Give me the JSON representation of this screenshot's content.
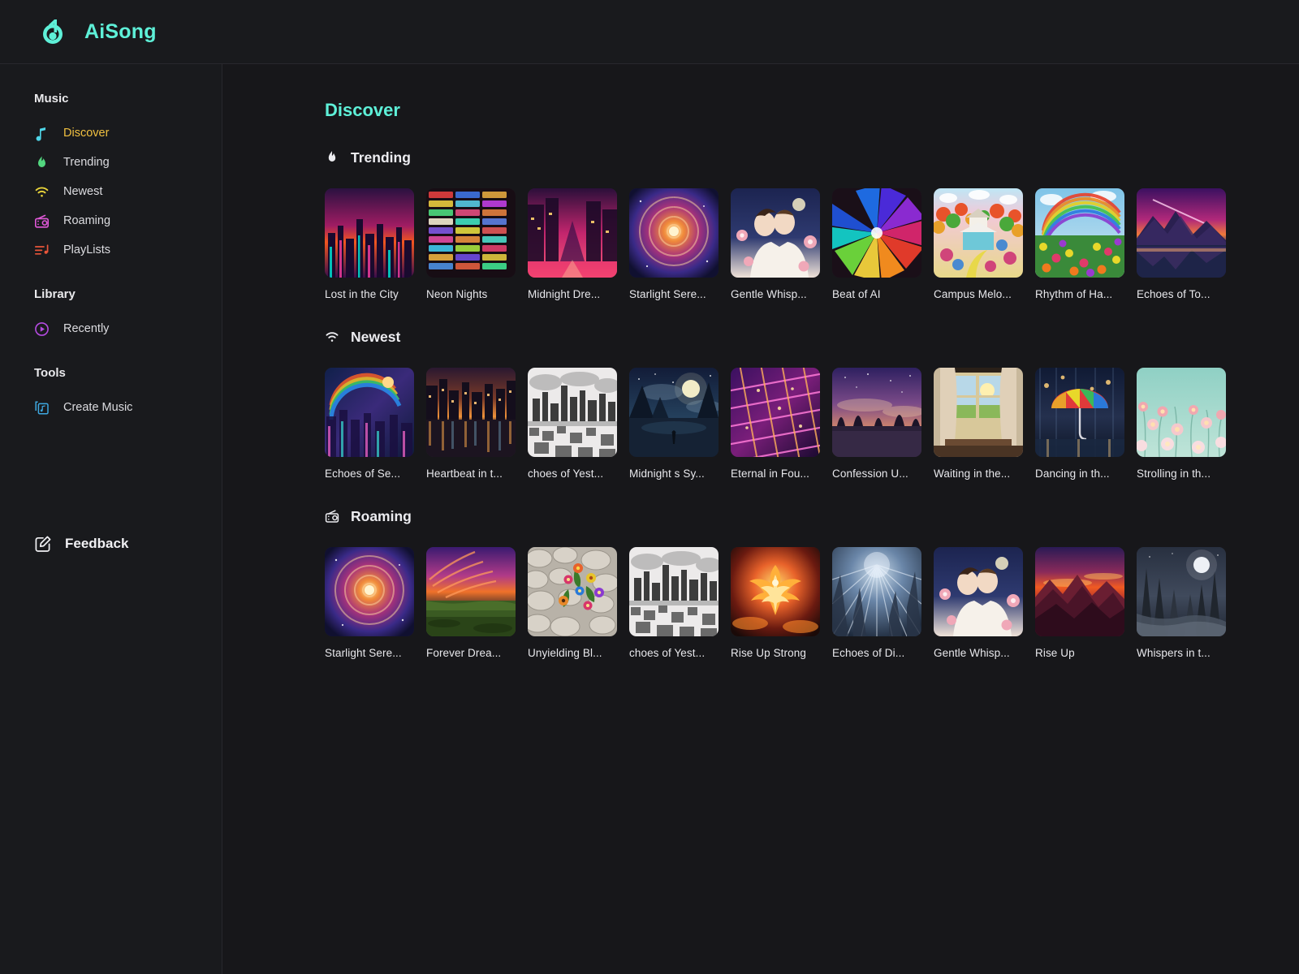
{
  "brand": {
    "name": "AiSong",
    "logo_icon": "music-note-b-logo",
    "accent": "#5ef0d8"
  },
  "sidebar": {
    "groups": [
      {
        "title": "Music",
        "items": [
          {
            "label": "Discover",
            "icon": "music-note-icon",
            "color": "#4fd6e8",
            "active": true
          },
          {
            "label": "Trending",
            "icon": "flame-icon",
            "color": "#52d67f",
            "active": false
          },
          {
            "label": "Newest",
            "icon": "wifi-icon",
            "color": "#e8d43a",
            "active": false
          },
          {
            "label": "Roaming",
            "icon": "radio-icon",
            "color": "#e058d8",
            "active": false
          },
          {
            "label": "PlayLists",
            "icon": "playlist-icon",
            "color": "#e8553a",
            "active": false
          }
        ]
      },
      {
        "title": "Library",
        "items": [
          {
            "label": "Recently",
            "icon": "play-circle-icon",
            "color": "#b44be0",
            "active": false
          }
        ]
      },
      {
        "title": "Tools",
        "items": [
          {
            "label": "Create Music",
            "icon": "music-box-icon",
            "color": "#3ea8e0",
            "active": false
          }
        ]
      }
    ],
    "feedback": {
      "label": "Feedback",
      "icon": "edit-square-icon"
    }
  },
  "main": {
    "page_title": "Discover",
    "sections": [
      {
        "title": "Trending",
        "icon": "flame-icon",
        "cards": [
          {
            "title": "Lost in the City",
            "art": "neon-city-skyline"
          },
          {
            "title": "Neon Nights",
            "art": "neon-signs-wall"
          },
          {
            "title": "Midnight Dre...",
            "art": "pink-city-street"
          },
          {
            "title": "Starlight Sere...",
            "art": "cosmic-spiral"
          },
          {
            "title": "Gentle Whisp...",
            "art": "couple-kiss-roses"
          },
          {
            "title": "Beat of AI",
            "art": "color-burst"
          },
          {
            "title": "Campus Melo...",
            "art": "colorful-campus"
          },
          {
            "title": "Rhythm of Ha...",
            "art": "rainbow-flower-field"
          },
          {
            "title": "Echoes of To...",
            "art": "purple-mountain-lake"
          }
        ]
      },
      {
        "title": "Newest",
        "icon": "wifi-icon",
        "cards": [
          {
            "title": "Echoes of Se...",
            "art": "rainbow-dream-city"
          },
          {
            "title": "Heartbeat in t...",
            "art": "city-river-dusk"
          },
          {
            "title": "choes of Yest...",
            "art": "bw-skyline-sketch"
          },
          {
            "title": "Midnight s Sy...",
            "art": "moonlit-forest"
          },
          {
            "title": "Eternal in Fou...",
            "art": "neon-grid-lattice"
          },
          {
            "title": "Confession U...",
            "art": "starry-treeline"
          },
          {
            "title": "Waiting in the...",
            "art": "window-curtains-sun"
          },
          {
            "title": "Dancing in th...",
            "art": "rainbow-umbrella-rain"
          },
          {
            "title": "Strolling in th...",
            "art": "pastel-poppy-field"
          }
        ]
      },
      {
        "title": "Roaming",
        "icon": "radio-icon",
        "cards": [
          {
            "title": "Starlight Sere...",
            "art": "cosmic-spiral"
          },
          {
            "title": "Forever Drea...",
            "art": "sunset-meadow"
          },
          {
            "title": "Unyielding Bl...",
            "art": "flowers-in-stones"
          },
          {
            "title": "choes of Yest...",
            "art": "bw-skyline-sketch"
          },
          {
            "title": "Rise Up Strong",
            "art": "phoenix-fire"
          },
          {
            "title": "Echoes of Di...",
            "art": "light-rays-forest"
          },
          {
            "title": "Gentle Whisp...",
            "art": "couple-kiss-roses"
          },
          {
            "title": "Rise Up",
            "art": "red-mountain-sunset"
          },
          {
            "title": "Whispers in t...",
            "art": "moon-winter-river"
          }
        ]
      }
    ]
  }
}
